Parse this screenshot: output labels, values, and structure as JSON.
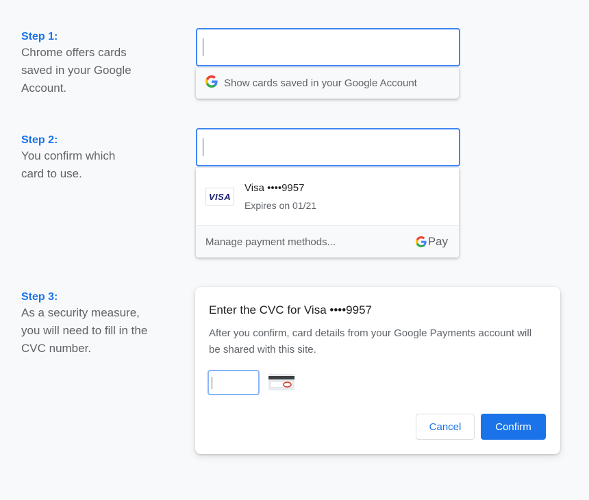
{
  "steps": [
    {
      "title": "Step 1:",
      "description": "Chrome offers cards saved in your Google Account."
    },
    {
      "title": "Step 2:",
      "description": "You confirm which card to use."
    },
    {
      "title": "Step 3:",
      "description": "As a security measure, you will need to fill in the CVC number."
    }
  ],
  "step1_dropdown": {
    "icon": "google-g-icon",
    "label": "Show cards saved in your Google Account"
  },
  "step2_dropdown": {
    "card_brand_logo": "VISA",
    "card_name": "Visa ••••9957",
    "card_expiry": "Expires on 01/21",
    "manage_label": "Manage payment methods...",
    "gpay_g": "G",
    "gpay_label": "Pay"
  },
  "cvc_dialog": {
    "title": "Enter the CVC for Visa ••••9957",
    "body": "After you confirm, card details from your Google Payments account will be shared with this site.",
    "cvc_value": "",
    "cancel_label": "Cancel",
    "confirm_label": "Confirm"
  },
  "colors": {
    "accent": "#1a73e8",
    "focus_border": "#4285f4",
    "text_secondary": "#5f6368",
    "visa_blue": "#1a1f71",
    "cvc_highlight": "#d93025"
  }
}
